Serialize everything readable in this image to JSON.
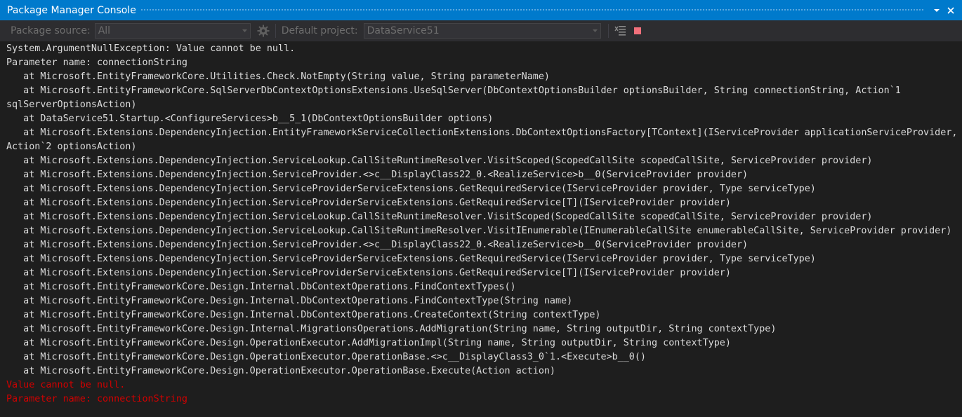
{
  "panel": {
    "title": "Package Manager Console",
    "menu_icon": "chevron-down-icon",
    "close_icon": "close-icon"
  },
  "toolbar": {
    "source_label": "Package source:",
    "source_value": "All",
    "settings_icon": "gear-icon",
    "project_label": "Default project:",
    "project_value": "DataService51",
    "clear_icon": "clear-console-icon",
    "stop_icon": "stop-icon"
  },
  "colors": {
    "title_bar": "#007acc",
    "toolbar": "#2d2d30",
    "console_bg": "#1e1e1e",
    "console_text": "#dcdcdc",
    "error_text": "#d20000",
    "stop": "#f1707b"
  },
  "console": {
    "lines": [
      {
        "text": "System.ArgumentNullException: Value cannot be null.",
        "error": false
      },
      {
        "text": "Parameter name: connectionString",
        "error": false
      },
      {
        "text": "   at Microsoft.EntityFrameworkCore.Utilities.Check.NotEmpty(String value, String parameterName)",
        "error": false
      },
      {
        "text": "   at Microsoft.EntityFrameworkCore.SqlServerDbContextOptionsExtensions.UseSqlServer(DbContextOptionsBuilder optionsBuilder, String connectionString, Action`1",
        "error": false
      },
      {
        "text": "sqlServerOptionsAction)",
        "error": false
      },
      {
        "text": "   at DataService51.Startup.<ConfigureServices>b__5_1(DbContextOptionsBuilder options)",
        "error": false
      },
      {
        "text": "   at Microsoft.Extensions.DependencyInjection.EntityFrameworkServiceCollectionExtensions.DbContextOptionsFactory[TContext](IServiceProvider applicationServiceProvider,",
        "error": false
      },
      {
        "text": "Action`2 optionsAction)",
        "error": false
      },
      {
        "text": "   at Microsoft.Extensions.DependencyInjection.ServiceLookup.CallSiteRuntimeResolver.VisitScoped(ScopedCallSite scopedCallSite, ServiceProvider provider)",
        "error": false
      },
      {
        "text": "   at Microsoft.Extensions.DependencyInjection.ServiceProvider.<>c__DisplayClass22_0.<RealizeService>b__0(ServiceProvider provider)",
        "error": false
      },
      {
        "text": "   at Microsoft.Extensions.DependencyInjection.ServiceProviderServiceExtensions.GetRequiredService(IServiceProvider provider, Type serviceType)",
        "error": false
      },
      {
        "text": "   at Microsoft.Extensions.DependencyInjection.ServiceProviderServiceExtensions.GetRequiredService[T](IServiceProvider provider)",
        "error": false
      },
      {
        "text": "   at Microsoft.Extensions.DependencyInjection.ServiceLookup.CallSiteRuntimeResolver.VisitScoped(ScopedCallSite scopedCallSite, ServiceProvider provider)",
        "error": false
      },
      {
        "text": "   at Microsoft.Extensions.DependencyInjection.ServiceLookup.CallSiteRuntimeResolver.VisitIEnumerable(IEnumerableCallSite enumerableCallSite, ServiceProvider provider)",
        "error": false
      },
      {
        "text": "   at Microsoft.Extensions.DependencyInjection.ServiceProvider.<>c__DisplayClass22_0.<RealizeService>b__0(ServiceProvider provider)",
        "error": false
      },
      {
        "text": "   at Microsoft.Extensions.DependencyInjection.ServiceProviderServiceExtensions.GetRequiredService(IServiceProvider provider, Type serviceType)",
        "error": false
      },
      {
        "text": "   at Microsoft.Extensions.DependencyInjection.ServiceProviderServiceExtensions.GetRequiredService[T](IServiceProvider provider)",
        "error": false
      },
      {
        "text": "   at Microsoft.EntityFrameworkCore.Design.Internal.DbContextOperations.FindContextTypes()",
        "error": false
      },
      {
        "text": "   at Microsoft.EntityFrameworkCore.Design.Internal.DbContextOperations.FindContextType(String name)",
        "error": false
      },
      {
        "text": "   at Microsoft.EntityFrameworkCore.Design.Internal.DbContextOperations.CreateContext(String contextType)",
        "error": false
      },
      {
        "text": "   at Microsoft.EntityFrameworkCore.Design.Internal.MigrationsOperations.AddMigration(String name, String outputDir, String contextType)",
        "error": false
      },
      {
        "text": "   at Microsoft.EntityFrameworkCore.Design.OperationExecutor.AddMigrationImpl(String name, String outputDir, String contextType)",
        "error": false
      },
      {
        "text": "   at Microsoft.EntityFrameworkCore.Design.OperationExecutor.OperationBase.<>c__DisplayClass3_0`1.<Execute>b__0()",
        "error": false
      },
      {
        "text": "   at Microsoft.EntityFrameworkCore.Design.OperationExecutor.OperationBase.Execute(Action action)",
        "error": false
      },
      {
        "text": "Value cannot be null.",
        "error": true
      },
      {
        "text": "Parameter name: connectionString",
        "error": true
      }
    ]
  }
}
